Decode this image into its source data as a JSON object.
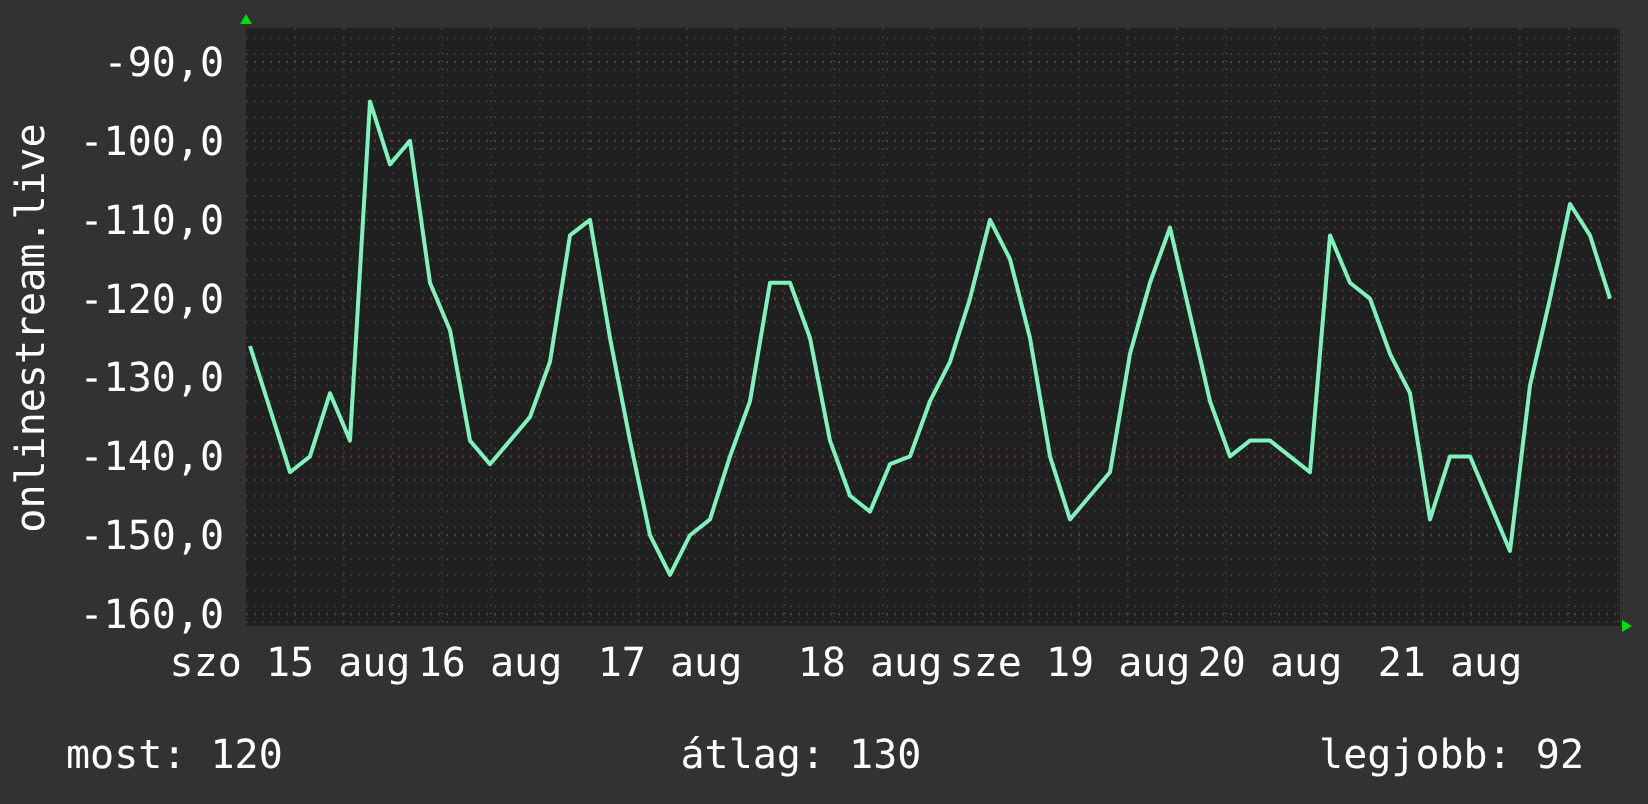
{
  "chart": {
    "chart_data": {
      "type": "line",
      "ylabel": "onlinestream.live",
      "grid": true,
      "categories": [
        null,
        null,
        "szo 15 aug",
        null,
        null,
        null,
        null,
        null,
        null,
        null,
        null,
        null,
        "16 aug",
        null,
        null,
        null,
        null,
        null,
        null,
        null,
        null,
        "17 aug",
        null,
        null,
        null,
        null,
        null,
        null,
        null,
        null,
        null,
        "18 aug",
        null,
        null,
        null,
        null,
        null,
        null,
        null,
        null,
        null,
        "sze 19 aug",
        null,
        null,
        null,
        null,
        null,
        null,
        null,
        null,
        null,
        "20 aug",
        null,
        null,
        null,
        null,
        null,
        null,
        null,
        null,
        "21 aug",
        null,
        null,
        null,
        null,
        null,
        null,
        null,
        null
      ],
      "ylim": [
        -161.5,
        -85.7
      ],
      "yticks": [
        {
          "value": -90,
          "label": "-90,0"
        },
        {
          "value": -100,
          "label": "-100,0"
        },
        {
          "value": -110,
          "label": "-110,0"
        },
        {
          "value": -120,
          "label": "-120,0"
        },
        {
          "value": -130,
          "label": "-130,0"
        },
        {
          "value": -140,
          "label": "-140,0"
        },
        {
          "value": -150,
          "label": "-150,0"
        },
        {
          "value": -160,
          "label": "-160,0"
        }
      ],
      "series": [
        {
          "color": "#80f2bc",
          "values": [
            -126,
            -134,
            -142,
            -140,
            -132,
            -138,
            -95,
            -103,
            -100,
            -118,
            -124,
            -138,
            -141,
            -138,
            -135,
            -128,
            -112,
            -110,
            -125,
            -138,
            -150,
            -155,
            -150,
            -148,
            -140,
            -133,
            -118,
            -118,
            -125,
            -138,
            -145,
            -147,
            -141,
            -140,
            -133,
            -128,
            -120,
            -110,
            -115,
            -125,
            -140,
            -148,
            -145,
            -142,
            -127,
            -118,
            -111,
            -122,
            -133,
            -140,
            -138,
            -138,
            -140,
            -142,
            -112,
            -118,
            -120,
            -127,
            -132,
            -148,
            -140,
            -140,
            -146,
            -152,
            -131,
            -120,
            -108,
            -112,
            -120
          ]
        }
      ]
    }
  },
  "footer": [
    "most: 120",
    "átlag: 130",
    "legjobb: 92"
  ]
}
